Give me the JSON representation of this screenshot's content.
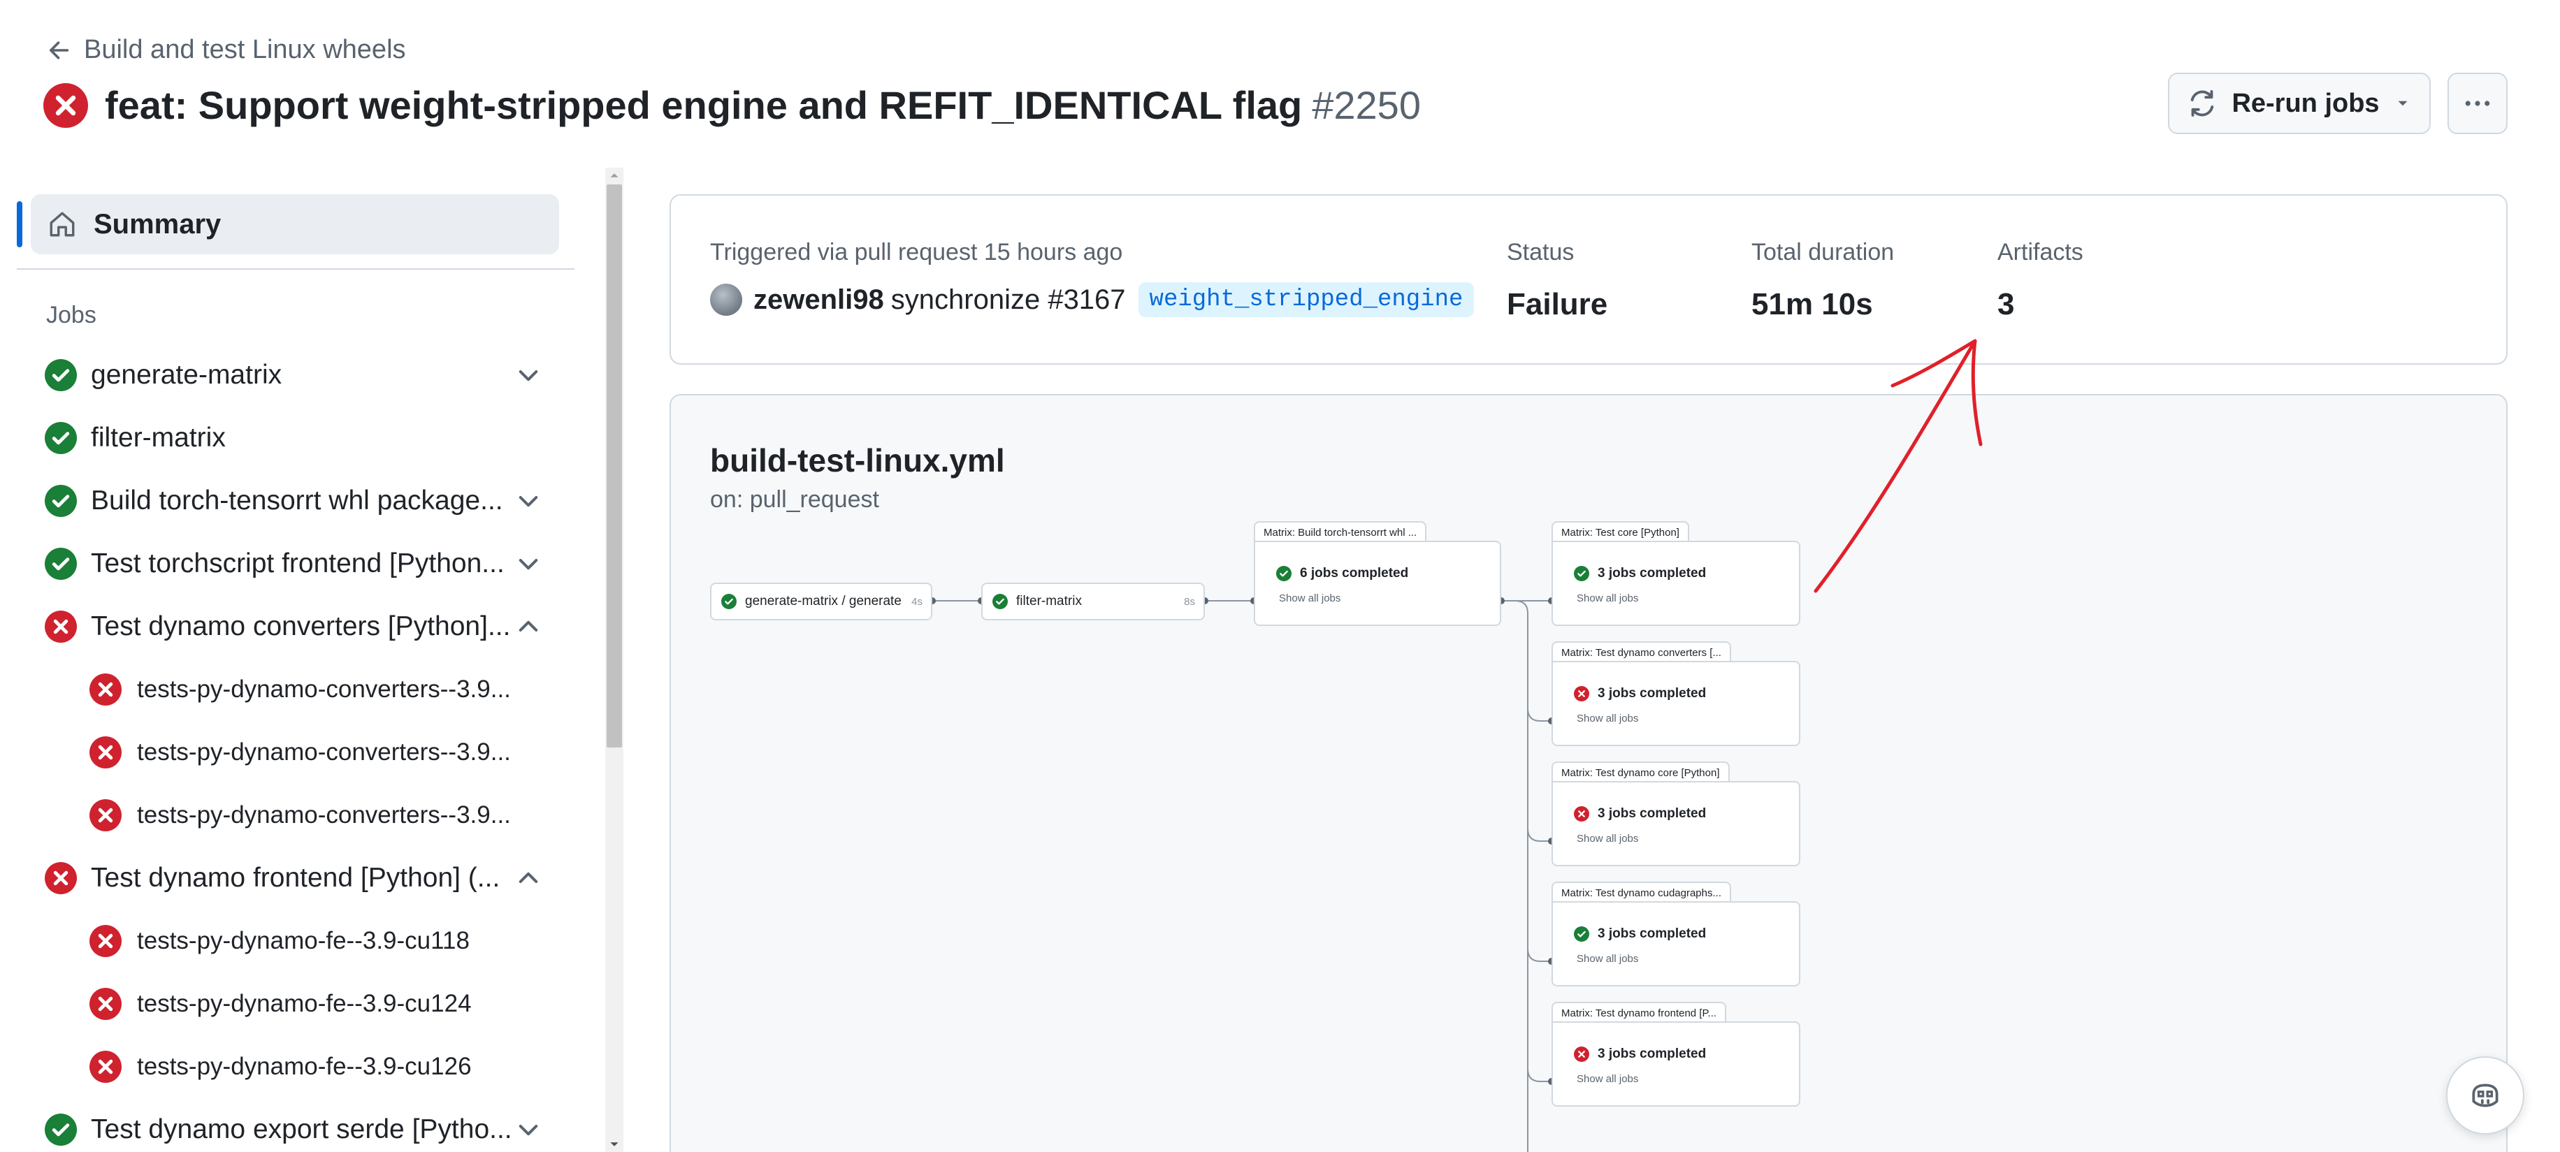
{
  "header": {
    "back_label": "Build and test Linux wheels",
    "title": "feat: Support weight-stripped engine and REFIT_IDENTICAL flag",
    "run_number": "#2250",
    "rerun_label": "Re-run jobs"
  },
  "sidebar": {
    "summary_label": "Summary",
    "jobs_label": "Jobs",
    "jobs": [
      {
        "label": "generate-matrix",
        "status": "success",
        "level": 0,
        "chevron": "down"
      },
      {
        "label": "filter-matrix",
        "status": "success",
        "level": 0,
        "chevron": "none"
      },
      {
        "label": "Build torch-tensorrt whl package...",
        "status": "success",
        "level": 0,
        "chevron": "down"
      },
      {
        "label": "Test torchscript frontend [Python...",
        "status": "success",
        "level": 0,
        "chevron": "down"
      },
      {
        "label": "Test dynamo converters [Python]...",
        "status": "failure",
        "level": 0,
        "chevron": "up"
      },
      {
        "label": "tests-py-dynamo-converters--3.9...",
        "status": "failure",
        "level": 1,
        "chevron": "none"
      },
      {
        "label": "tests-py-dynamo-converters--3.9...",
        "status": "failure",
        "level": 1,
        "chevron": "none"
      },
      {
        "label": "tests-py-dynamo-converters--3.9...",
        "status": "failure",
        "level": 1,
        "chevron": "none"
      },
      {
        "label": "Test dynamo frontend [Python] (...",
        "status": "failure",
        "level": 0,
        "chevron": "up"
      },
      {
        "label": "tests-py-dynamo-fe--3.9-cu118",
        "status": "failure",
        "level": 1,
        "chevron": "none"
      },
      {
        "label": "tests-py-dynamo-fe--3.9-cu124",
        "status": "failure",
        "level": 1,
        "chevron": "none"
      },
      {
        "label": "tests-py-dynamo-fe--3.9-cu126",
        "status": "failure",
        "level": 1,
        "chevron": "none"
      },
      {
        "label": "Test dynamo export serde [Pytho...",
        "status": "success",
        "level": 0,
        "chevron": "down"
      }
    ]
  },
  "summary": {
    "triggered": "Triggered via pull request 15 hours ago",
    "user": "zewenli98",
    "action": "synchronize #3167",
    "branch": "weight_stripped_engine",
    "status_label": "Status",
    "status_value": "Failure",
    "duration_label": "Total duration",
    "duration_value": "51m 10s",
    "artifacts_label": "Artifacts",
    "artifacts_value": "3"
  },
  "workflow": {
    "file": "build-test-linux.yml",
    "trigger": "on: pull_request",
    "nodes": {
      "generate": {
        "label": "generate-matrix / generate",
        "duration": "4s",
        "status": "success"
      },
      "filter": {
        "label": "filter-matrix",
        "duration": "8s",
        "status": "success"
      }
    },
    "matrices": [
      {
        "title": "Matrix: Build torch-tensorrt whl ...",
        "summary": "6 jobs completed",
        "link": "Show all jobs",
        "status": "success"
      },
      {
        "title": "Matrix: Test core [Python]",
        "summary": "3 jobs completed",
        "link": "Show all jobs",
        "status": "success"
      },
      {
        "title": "Matrix: Test dynamo converters [...",
        "summary": "3 jobs completed",
        "link": "Show all jobs",
        "status": "failure"
      },
      {
        "title": "Matrix: Test dynamo core [Python]",
        "summary": "3 jobs completed",
        "link": "Show all jobs",
        "status": "failure"
      },
      {
        "title": "Matrix: Test dynamo cudagraphs...",
        "summary": "3 jobs completed",
        "link": "Show all jobs",
        "status": "success"
      },
      {
        "title": "Matrix: Test dynamo frontend [P...",
        "summary": "3 jobs completed",
        "link": "Show all jobs",
        "status": "failure"
      }
    ]
  },
  "colors": {
    "success": "#1a7f37",
    "failure": "#cf222e",
    "accent": "#0969da",
    "annotation": "#e0202a"
  }
}
